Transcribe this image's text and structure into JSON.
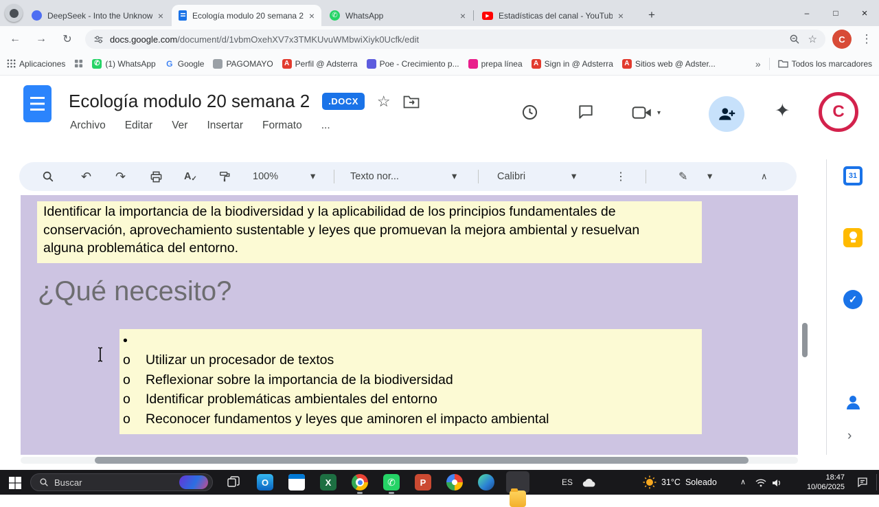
{
  "browser": {
    "tabs": [
      {
        "label": "DeepSeek - Into the Unknown"
      },
      {
        "label": "Ecología modulo 20 semana 2...",
        "active": true
      },
      {
        "label": "WhatsApp"
      },
      {
        "label": "Estadísticas del canal - YouTub..."
      }
    ],
    "url_host": "docs.google.com",
    "url_path": "/document/d/1vbmOxehXV7x3TMKUvuWMbwiXiyk0Ucfk/edit",
    "profile_initial": "C",
    "bookmarks_bar": {
      "items": [
        {
          "label": "Aplicaciones"
        },
        {
          "label": "(1) WhatsApp"
        },
        {
          "label": "Google"
        },
        {
          "label": "PAGOMAYO"
        },
        {
          "label": "Perfil @ Adsterra"
        },
        {
          "label": "Poe - Crecimiento p..."
        },
        {
          "label": "prepa línea"
        },
        {
          "label": "Sign in @ Adsterra"
        },
        {
          "label": "Sitios web @ Adster..."
        },
        {
          "label": "Todos los marcadores"
        }
      ]
    }
  },
  "docs": {
    "title": "Ecología modulo 20 semana 2",
    "file_type_badge": ".DOCX",
    "menu_items": [
      "Archivo",
      "Editar",
      "Ver",
      "Insertar",
      "Formato",
      "..."
    ],
    "toolbar": {
      "zoom": "100%",
      "paragraph_style": "Texto nor...",
      "font": "Calibri"
    }
  },
  "document": {
    "intro_paragraph": "Identificar la importancia de la biodiversidad y la aplicabilidad de los principios fundamentales de conservación, aprovechamiento sustentable y leyes que promuevan la mejora ambiental y resuelvan alguna problemática del entorno.",
    "heading": "¿Qué necesito?",
    "list_items": [
      {
        "marker": "•",
        "text": ""
      },
      {
        "marker": "o",
        "text": "Utilizar un procesador de textos"
      },
      {
        "marker": "o",
        "text": "Reflexionar sobre la importancia de la biodiversidad"
      },
      {
        "marker": "o",
        "text": "Identificar problemáticas ambientales del entorno"
      },
      {
        "marker": "o",
        "text": "Reconocer fundamentos y leyes que aminoren el impacto ambiental"
      }
    ]
  },
  "side_panel": {
    "calendar_day": "31"
  },
  "taskbar": {
    "search_placeholder": "Buscar",
    "language": "ES",
    "weather": {
      "temperature": "31°C",
      "condition": "Soleado"
    },
    "clock": {
      "time": "18:47",
      "date": "10/06/2025"
    }
  },
  "icons": {
    "back": "←",
    "forward": "→",
    "reload": "↻",
    "star": "☆",
    "menu_dots": "⋮",
    "close": "×",
    "new_tab": "+",
    "minimize": "–",
    "maximize": "□",
    "caret_down": "▾",
    "chevron_right": "›",
    "collapse": "∧",
    "undo": "↶",
    "redo": "↷",
    "overflow": "»",
    "sparkle": "✦",
    "pen": "✎",
    "phone": "✆",
    "play": "▶",
    "check": "✓",
    "spell_a": "A",
    "tray_up": "∧",
    "google_g": "G",
    "adsterra_a": "A",
    "outlook_o": "O",
    "excel_x": "X",
    "powerpoint_p": "P"
  },
  "colors": {
    "accent_blue": "#1a73e8",
    "doc_page_background": "#cdc4e2",
    "paragraph_highlight": "#fcfad4",
    "badge_blue": "#1a73e8",
    "taskbar_background": "#18181b"
  }
}
